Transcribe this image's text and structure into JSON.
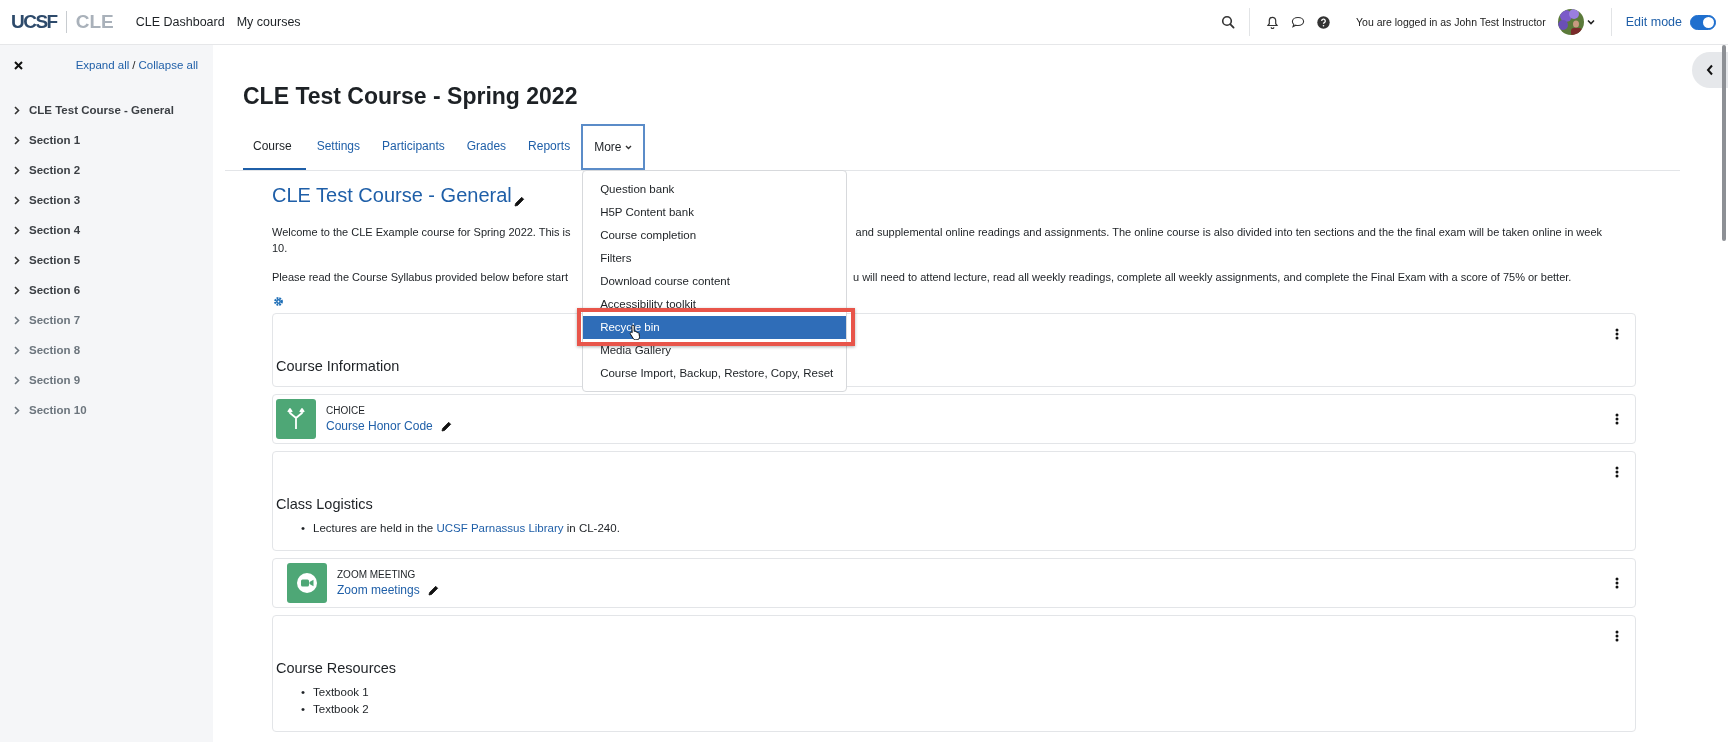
{
  "header": {
    "logo_primary": "UCSF",
    "logo_secondary": "CLE",
    "nav": [
      {
        "label": "CLE Dashboard"
      },
      {
        "label": "My courses"
      }
    ],
    "user_text": "You are logged in as John Test Instructor",
    "edit_mode": {
      "label": "Edit mode",
      "on": true
    }
  },
  "drawer": {
    "expand_all": "Expand all",
    "separator": "/",
    "collapse_all": "Collapse all",
    "items": [
      {
        "label": "CLE Test Course - General",
        "hidden": false
      },
      {
        "label": "Section 1",
        "hidden": false
      },
      {
        "label": "Section 2",
        "hidden": false
      },
      {
        "label": "Section 3",
        "hidden": false
      },
      {
        "label": "Section 4",
        "hidden": false
      },
      {
        "label": "Section 5",
        "hidden": false
      },
      {
        "label": "Section 6",
        "hidden": false
      },
      {
        "label": "Section 7",
        "hidden": true
      },
      {
        "label": "Section 8",
        "hidden": true
      },
      {
        "label": "Section 9",
        "hidden": true
      },
      {
        "label": "Section 10",
        "hidden": true
      }
    ]
  },
  "course": {
    "title": "CLE Test Course - Spring 2022",
    "tabs": [
      {
        "label": "Course",
        "selected": true
      },
      {
        "label": "Settings",
        "selected": false
      },
      {
        "label": "Participants",
        "selected": false
      },
      {
        "label": "Grades",
        "selected": false
      },
      {
        "label": "Reports",
        "selected": false
      }
    ],
    "more_menu": {
      "label": "More",
      "expanded": true,
      "items": [
        {
          "label": "Question bank",
          "selected": false
        },
        {
          "label": "H5P Content bank",
          "selected": false
        },
        {
          "label": "Course completion",
          "selected": false
        },
        {
          "label": "Filters",
          "selected": false
        },
        {
          "label": "Download course content",
          "selected": false
        },
        {
          "label": "Accessibility toolkit",
          "selected": false
        },
        {
          "label": "Recycle bin",
          "selected": true
        },
        {
          "label": "Media Gallery",
          "selected": false
        },
        {
          "label": "Course Import, Backup, Restore, Copy, Reset",
          "selected": false
        }
      ]
    }
  },
  "section": {
    "title": "CLE Test Course - General",
    "paragraphs": [
      {
        "start": "Welcome to the CLE Example course for Spring 2022. This is",
        "end": "and supplemental online readings and assignments. The online course is also divided into ten sections and the the final exam will be taken online in week",
        "wrap": "10."
      },
      {
        "start": "Please read the Course Syllabus provided below before start",
        "end": "u will need to attend lecture, read all weekly readings, complete all weekly assignments, and complete the Final Exam with a score of 75% or better."
      }
    ]
  },
  "blocks": [
    {
      "kind": "section",
      "title": "Course Information"
    },
    {
      "kind": "choice",
      "type": "CHOICE",
      "link": "Course Honor Code",
      "indented": false
    },
    {
      "kind": "section",
      "title": "Class Logistics",
      "bullets": [
        {
          "marker": "•",
          "parts": [
            {
              "text": "Lectures are held in the "
            },
            {
              "link": "UCSF Parnassus Library"
            },
            {
              "text": " in CL-240."
            }
          ]
        }
      ]
    },
    {
      "kind": "zoom",
      "type": "ZOOM MEETING",
      "link": "Zoom meetings",
      "indented": true
    },
    {
      "kind": "section",
      "title": "Course Resources",
      "bullets": [
        {
          "marker": "•",
          "parts": [
            {
              "text": "Textbook 1"
            }
          ]
        },
        {
          "marker": "•",
          "parts": [
            {
              "text": "Textbook 2"
            }
          ]
        }
      ]
    }
  ]
}
